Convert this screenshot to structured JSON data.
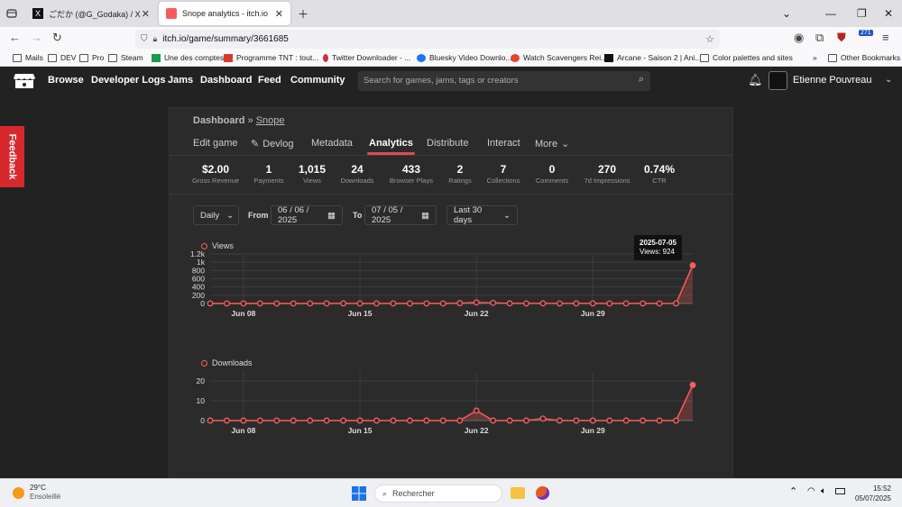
{
  "browser": {
    "tabs": [
      {
        "title": "ごだか (@G_Godaka) / X",
        "active": false
      },
      {
        "title": "Snope analytics - itch.io",
        "active": true
      }
    ],
    "url": "itch.io/game/summary/3661685",
    "bookmarks": [
      "Mails",
      "DEV",
      "Pro",
      "Steam",
      "Une des comptes",
      "Programme TNT : tout...",
      "Twitter Downloader - ...",
      "Bluesky Video Downlo...",
      "Watch Scavengers Rei...",
      "Arcane - Saison 2 | Ani...",
      "Color palettes and sites"
    ],
    "other_bookmarks": "Other Bookmarks",
    "ext_badge": "271"
  },
  "itch_nav": {
    "links": [
      "Browse",
      "Developer Logs",
      "Jams",
      "Dashboard",
      "Feed",
      "Community"
    ],
    "search_placeholder": "Search for games, jams, tags or creators",
    "username": "Etienne Pouvreau"
  },
  "feedback": "Feedback",
  "breadcrumb": {
    "root": "Dashboard",
    "sep": "»",
    "game": "Snope"
  },
  "tabs": [
    "Edit game",
    "Devlog",
    "Metadata",
    "Analytics",
    "Distribute",
    "Interact",
    "More"
  ],
  "active_tab": "Analytics",
  "stats": [
    {
      "value": "$2.00",
      "label": "Gross Revenue"
    },
    {
      "value": "1",
      "label": "Payments"
    },
    {
      "value": "1,015",
      "label": "Views"
    },
    {
      "value": "24",
      "label": "Downloads"
    },
    {
      "value": "433",
      "label": "Browser Plays"
    },
    {
      "value": "2",
      "label": "Ratings"
    },
    {
      "value": "7",
      "label": "Collections"
    },
    {
      "value": "0",
      "label": "Comments"
    },
    {
      "value": "270",
      "label": "7d Impressions"
    },
    {
      "value": "0.74%",
      "label": "CTR"
    }
  ],
  "filters": {
    "interval": "Daily",
    "from_label": "From",
    "from_date": "06 / 06 / 2025",
    "to_label": "To",
    "to_date": "07 / 05 / 2025",
    "range": "Last 30 days"
  },
  "tooltip": {
    "date": "2025-07-05",
    "text": "Views: 924"
  },
  "taskbar": {
    "temp": "29°C",
    "weather": "Ensoleillé",
    "search": "Rechercher",
    "time": "15:52",
    "date": "05/07/2025"
  },
  "colors": {
    "accent": "#fa5c5c",
    "tab_underline": "#e04a5a",
    "feedback": "#d7282e"
  },
  "chart_data": [
    {
      "type": "line",
      "title": "Views",
      "x": [
        "2025-06-06",
        "2025-06-07",
        "2025-06-08",
        "2025-06-09",
        "2025-06-10",
        "2025-06-11",
        "2025-06-12",
        "2025-06-13",
        "2025-06-14",
        "2025-06-15",
        "2025-06-16",
        "2025-06-17",
        "2025-06-18",
        "2025-06-19",
        "2025-06-20",
        "2025-06-21",
        "2025-06-22",
        "2025-06-23",
        "2025-06-24",
        "2025-06-25",
        "2025-06-26",
        "2025-06-27",
        "2025-06-28",
        "2025-06-29",
        "2025-06-30",
        "2025-07-01",
        "2025-07-02",
        "2025-07-03",
        "2025-07-04",
        "2025-07-05"
      ],
      "values": [
        2,
        1,
        1,
        2,
        1,
        1,
        1,
        1,
        2,
        1,
        1,
        1,
        1,
        2,
        1,
        8,
        25,
        15,
        3,
        2,
        3,
        2,
        3,
        2,
        1,
        1,
        2,
        1,
        2,
        924
      ],
      "xticks": [
        "Jun 08",
        "Jun 15",
        "Jun 22",
        "Jun 29"
      ],
      "yticks": [
        "0",
        "200",
        "400",
        "600",
        "800",
        "1k",
        "1.2k"
      ],
      "ylim": [
        0,
        1200
      ]
    },
    {
      "type": "line",
      "title": "Downloads",
      "x": [
        "2025-06-06",
        "2025-06-07",
        "2025-06-08",
        "2025-06-09",
        "2025-06-10",
        "2025-06-11",
        "2025-06-12",
        "2025-06-13",
        "2025-06-14",
        "2025-06-15",
        "2025-06-16",
        "2025-06-17",
        "2025-06-18",
        "2025-06-19",
        "2025-06-20",
        "2025-06-21",
        "2025-06-22",
        "2025-06-23",
        "2025-06-24",
        "2025-06-25",
        "2025-06-26",
        "2025-06-27",
        "2025-06-28",
        "2025-06-29",
        "2025-06-30",
        "2025-07-01",
        "2025-07-02",
        "2025-07-03",
        "2025-07-04",
        "2025-07-05"
      ],
      "values": [
        0,
        0,
        0,
        0,
        0,
        0,
        0,
        0,
        0,
        0,
        0,
        0,
        0,
        0,
        0,
        0,
        5,
        0,
        0,
        0,
        1,
        0,
        0,
        0,
        0,
        0,
        0,
        0,
        0,
        18
      ],
      "xticks": [
        "Jun 08",
        "Jun 15",
        "Jun 22",
        "Jun 29"
      ],
      "yticks": [
        "0",
        "10",
        "20"
      ],
      "ylim": [
        0,
        25
      ]
    }
  ]
}
